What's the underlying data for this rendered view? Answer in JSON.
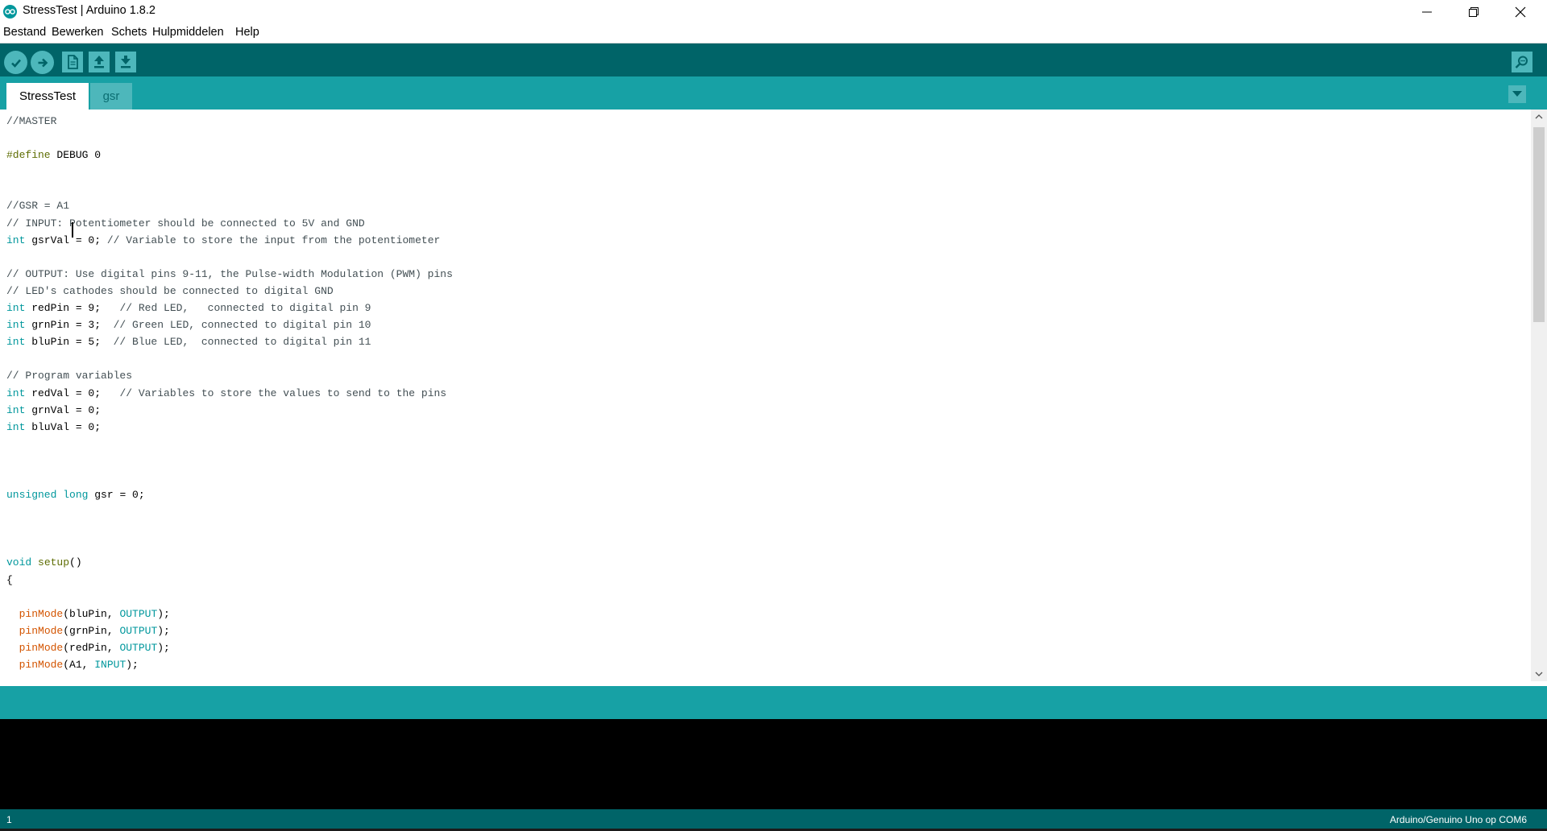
{
  "window": {
    "title": "StressTest | Arduino 1.8.2",
    "controls": [
      "minimize",
      "maximize",
      "close"
    ]
  },
  "menu": [
    "Bestand",
    "Bewerken",
    "Schets",
    "Hulpmiddelen",
    "Help"
  ],
  "toolbar": {
    "icons": [
      "check-icon",
      "arrow-right-icon",
      "new-sketch-icon",
      "open-icon",
      "save-icon",
      "serial-monitor-icon"
    ]
  },
  "tabs": [
    {
      "label": "StressTest",
      "active": true
    },
    {
      "label": "gsr",
      "active": false
    }
  ],
  "editor": {
    "lines": [
      [
        {
          "t": "//MASTER ",
          "c": "c"
        }
      ],
      [],
      [
        {
          "t": "#define",
          "c": "pp"
        },
        {
          "t": " DEBUG 0"
        }
      ],
      [],
      [],
      [
        {
          "t": "//GSR = A1",
          "c": "c"
        }
      ],
      [
        {
          "t": "// INPUT: Potentiometer should be connected to 5V and GND",
          "c": "c"
        }
      ],
      [
        {
          "t": "int",
          "c": "k"
        },
        {
          "t": " gsrVal = 0; "
        },
        {
          "t": "// Variable to store the input from the potentiometer",
          "c": "c"
        }
      ],
      [],
      [
        {
          "t": "// OUTPUT: Use digital pins 9-11, the Pulse-width Modulation (PWM) pins",
          "c": "c"
        }
      ],
      [
        {
          "t": "// LED's cathodes should be connected to digital GND",
          "c": "c"
        }
      ],
      [
        {
          "t": "int",
          "c": "k"
        },
        {
          "t": " redPin = 9;   "
        },
        {
          "t": "// Red LED,   connected to digital pin 9",
          "c": "c"
        }
      ],
      [
        {
          "t": "int",
          "c": "k"
        },
        {
          "t": " grnPin = 3;  "
        },
        {
          "t": "// Green LED, connected to digital pin 10",
          "c": "c"
        }
      ],
      [
        {
          "t": "int",
          "c": "k"
        },
        {
          "t": " bluPin = 5;  "
        },
        {
          "t": "// Blue LED,  connected to digital pin 11",
          "c": "c"
        }
      ],
      [],
      [
        {
          "t": "// Program variables",
          "c": "c"
        }
      ],
      [
        {
          "t": "int",
          "c": "k"
        },
        {
          "t": " redVal = 0;   "
        },
        {
          "t": "// Variables to store the values to send to the pins",
          "c": "c"
        }
      ],
      [
        {
          "t": "int",
          "c": "k"
        },
        {
          "t": " grnVal = 0;"
        }
      ],
      [
        {
          "t": "int",
          "c": "k"
        },
        {
          "t": " bluVal = 0;"
        }
      ],
      [],
      [],
      [],
      [
        {
          "t": "unsigned",
          "c": "k"
        },
        {
          "t": " "
        },
        {
          "t": "long",
          "c": "k"
        },
        {
          "t": " gsr = 0;"
        }
      ],
      [],
      [],
      [],
      [
        {
          "t": "void",
          "c": "k"
        },
        {
          "t": " "
        },
        {
          "t": "setup",
          "c": "pp"
        },
        {
          "t": "()"
        }
      ],
      [
        {
          "t": "{"
        }
      ],
      [],
      [
        {
          "t": "  "
        },
        {
          "t": "pinMode",
          "c": "f"
        },
        {
          "t": "(bluPin, "
        },
        {
          "t": "OUTPUT",
          "c": "cst"
        },
        {
          "t": ");"
        }
      ],
      [
        {
          "t": "  "
        },
        {
          "t": "pinMode",
          "c": "f"
        },
        {
          "t": "(grnPin, "
        },
        {
          "t": "OUTPUT",
          "c": "cst"
        },
        {
          "t": ");"
        }
      ],
      [
        {
          "t": "  "
        },
        {
          "t": "pinMode",
          "c": "f"
        },
        {
          "t": "(redPin, "
        },
        {
          "t": "OUTPUT",
          "c": "cst"
        },
        {
          "t": ");"
        }
      ],
      [
        {
          "t": "  "
        },
        {
          "t": "pinMode",
          "c": "f"
        },
        {
          "t": "(A1, "
        },
        {
          "t": "INPUT",
          "c": "cst"
        },
        {
          "t": ");"
        }
      ]
    ]
  },
  "status": {
    "line": "1",
    "board": "Arduino/Genuino Uno op COM6"
  },
  "colors": {
    "toolbar": "#006468",
    "tabbar": "#17a1a5",
    "button": "#4db7bb",
    "keyword": "#00979c",
    "comment": "#434f54",
    "function": "#d35400",
    "preprocessor": "#5e6d03"
  }
}
